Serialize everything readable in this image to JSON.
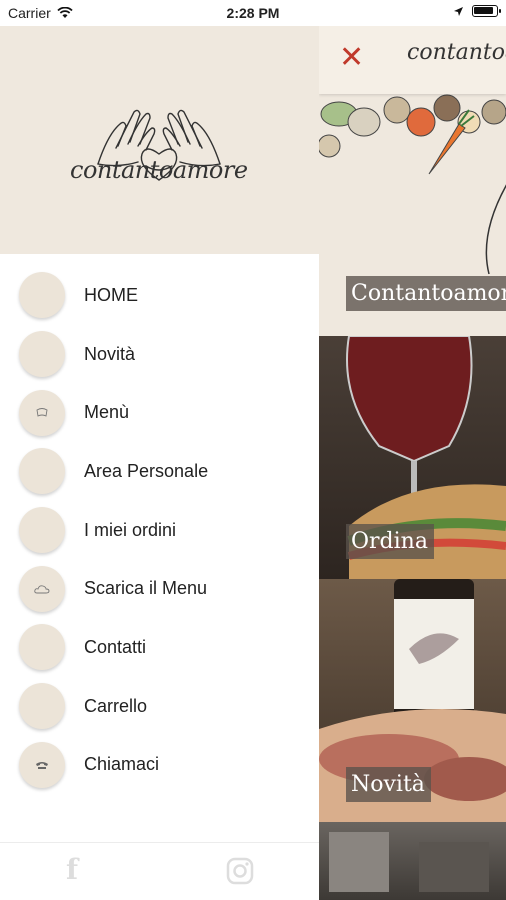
{
  "status_bar": {
    "carrier": "Carrier",
    "time": "2:28 PM"
  },
  "drawer": {
    "logo_text": "contantoamore",
    "menu": [
      {
        "label": "HOME",
        "icon": "home-icon"
      },
      {
        "label": "Novità",
        "icon": "news-icon"
      },
      {
        "label": "Menù",
        "icon": "menu-book-icon"
      },
      {
        "label": "Area Personale",
        "icon": "user-icon"
      },
      {
        "label": "I miei ordini",
        "icon": "orders-icon"
      },
      {
        "label": "Scarica il Menu",
        "icon": "download-cloud-icon"
      },
      {
        "label": "Contatti",
        "icon": "contact-icon"
      },
      {
        "label": "Carrello",
        "icon": "cart-icon"
      },
      {
        "label": "Chiamaci",
        "icon": "phone-icon"
      }
    ],
    "footer": {
      "facebook_icon": "facebook-icon",
      "instagram_icon": "instagram-icon"
    }
  },
  "content": {
    "title": "contantoamore",
    "close_icon": "close-icon",
    "tiles": [
      {
        "label": "Contantoamore"
      },
      {
        "label": "Ordina"
      },
      {
        "label": "Novità"
      },
      {
        "label": ""
      }
    ]
  },
  "colors": {
    "header_bg": "#efe8de",
    "icon_bg": "#ece4d8",
    "close": "#c0392b"
  }
}
